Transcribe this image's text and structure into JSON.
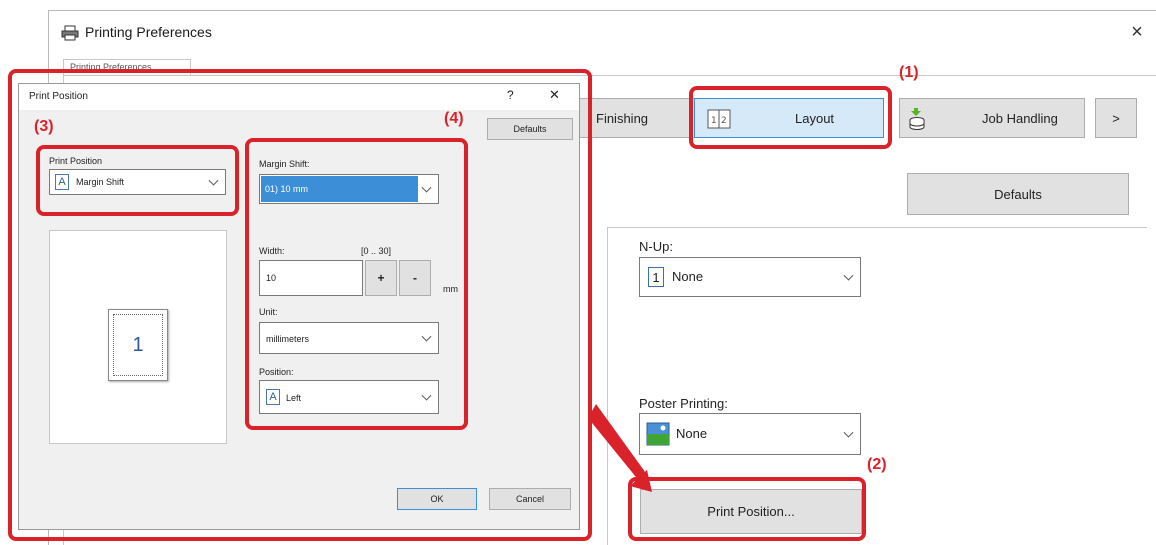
{
  "main": {
    "title": "Printing Preferences",
    "back_tab": "Printing Preferences",
    "tabs": [
      {
        "label": "Finishing"
      },
      {
        "label": "Layout"
      },
      {
        "label": "Job Handling"
      },
      {
        "label": ">"
      }
    ],
    "defaults_label": "Defaults",
    "nup": {
      "label": "N-Up:",
      "value": "None",
      "glyph": "1"
    },
    "poster": {
      "label": "Poster Printing:",
      "value": "None"
    },
    "print_position_button": "Print Position..."
  },
  "dialog": {
    "title": "Print Position",
    "help": "?",
    "close": "✕",
    "defaults_label": "Defaults",
    "print_position": {
      "label": "Print Position",
      "value": "Margin Shift",
      "glyph": "A"
    },
    "preview_page": "1",
    "margin_shift": {
      "label": "Margin Shift:",
      "value": "01) 10 mm"
    },
    "width": {
      "label": "Width:",
      "range": "[0 .. 30]",
      "value": "10",
      "unit": "mm",
      "plus": "+",
      "minus": "-"
    },
    "unit": {
      "label": "Unit:",
      "value": "millimeters"
    },
    "position": {
      "label": "Position:",
      "value": "Left",
      "glyph": "A"
    },
    "ok_label": "OK",
    "cancel_label": "Cancel"
  },
  "annotations": {
    "label1": "(1)",
    "label2": "(2)",
    "label3": "(3)",
    "label4": "(4)",
    "color": "#d9222a"
  }
}
